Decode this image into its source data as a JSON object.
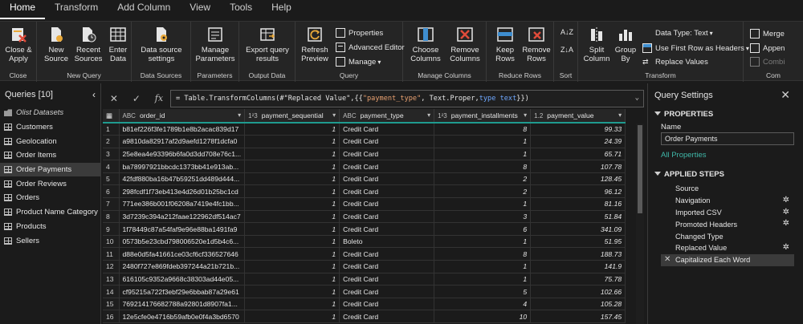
{
  "menu": {
    "tabs": [
      "Home",
      "Transform",
      "Add Column",
      "View",
      "Tools",
      "Help"
    ]
  },
  "ribbon": {
    "close_apply": "Close &\nApply",
    "new_source": "New\nSource",
    "recent_sources": "Recent\nSources",
    "enter_data": "Enter\nData",
    "data_source_settings": "Data source\nsettings",
    "manage_parameters": "Manage\nParameters",
    "export_query": "Export query\nresults",
    "refresh_preview": "Refresh\nPreview",
    "properties": "Properties",
    "advanced_editor": "Advanced Editor",
    "manage": "Manage",
    "choose_columns": "Choose\nColumns",
    "remove_columns": "Remove\nColumns",
    "keep_rows": "Keep\nRows",
    "remove_rows": "Remove\nRows",
    "split_column": "Split\nColumn",
    "group_by": "Group\nBy",
    "data_type": "Data Type: Text",
    "use_first_row": "Use First Row as Headers",
    "replace_values": "Replace Values",
    "merge": "Merge",
    "append": "Appen",
    "combine": "Combi",
    "groups": {
      "close": "Close",
      "new_query": "New Query",
      "data_sources": "Data Sources",
      "parameters": "Parameters",
      "output_data": "Output Data",
      "query": "Query",
      "manage_columns": "Manage Columns",
      "reduce_rows": "Reduce Rows",
      "sort": "Sort",
      "transform": "Transform",
      "combine": "Com"
    }
  },
  "queries": {
    "header": "Queries [10]",
    "items": [
      {
        "label": "Olist Datasets",
        "type": "folder"
      },
      {
        "label": "Customers",
        "type": "table"
      },
      {
        "label": "Geolocation",
        "type": "table"
      },
      {
        "label": "Order Items",
        "type": "table"
      },
      {
        "label": "Order Payments",
        "type": "table",
        "selected": true
      },
      {
        "label": "Order Reviews",
        "type": "table"
      },
      {
        "label": "Orders",
        "type": "table"
      },
      {
        "label": "Product Name Category",
        "type": "table"
      },
      {
        "label": "Products",
        "type": "table"
      },
      {
        "label": "Sellers",
        "type": "table"
      }
    ]
  },
  "formula": {
    "prefix": "= Table.TransformColumns(#\"Replaced Value\",{{",
    "str": "\"payment_type\"",
    "mid": ", Text.Proper, ",
    "kw": "type text",
    "suffix": "}})"
  },
  "table": {
    "columns": [
      {
        "type": "ABC",
        "name": "order_id"
      },
      {
        "type": "1²3",
        "name": "payment_sequential"
      },
      {
        "type": "ABC",
        "name": "payment_type"
      },
      {
        "type": "1²3",
        "name": "payment_installments"
      },
      {
        "type": "1.2",
        "name": "payment_value"
      }
    ],
    "rows": [
      [
        "1",
        "b81ef226f3fe1789b1e8b2acac839d17",
        "1",
        "Credit Card",
        "8",
        "99.33"
      ],
      [
        "2",
        "a9810da82917af2d9aefd1278f1dcfa0",
        "1",
        "Credit Card",
        "1",
        "24.39"
      ],
      [
        "3",
        "25e8ea4e93396b6fa0d3dd708e76c1...",
        "1",
        "Credit Card",
        "1",
        "65.71"
      ],
      [
        "4",
        "ba78997921bbcdc1373bb41e913ab...",
        "1",
        "Credit Card",
        "8",
        "107.78"
      ],
      [
        "5",
        "42fdf880ba16b47b59251dd489d444...",
        "1",
        "Credit Card",
        "2",
        "128.45"
      ],
      [
        "6",
        "298fcdf1f73eb413e4d26d01b25bc1cd",
        "1",
        "Credit Card",
        "2",
        "96.12"
      ],
      [
        "7",
        "771ee386b001f06208a7419e4fc1bb...",
        "1",
        "Credit Card",
        "1",
        "81.16"
      ],
      [
        "8",
        "3d7239c394a212faae122962df514ac7",
        "1",
        "Credit Card",
        "3",
        "51.84"
      ],
      [
        "9",
        "1f78449c87a54faf9e96e88ba1491fa9",
        "1",
        "Credit Card",
        "6",
        "341.09"
      ],
      [
        "10",
        "0573b5e23cbd798006520e1d5b4c6...",
        "1",
        "Boleto",
        "1",
        "51.95"
      ],
      [
        "11",
        "d88e0d5fa41661ce03cf6cf336527646",
        "1",
        "Credit Card",
        "8",
        "188.73"
      ],
      [
        "12",
        "2480f727e869fdeb397244a21b721b...",
        "1",
        "Credit Card",
        "1",
        "141.9"
      ],
      [
        "13",
        "616105c9352a9668c38303ad44e05...",
        "1",
        "Credit Card",
        "1",
        "75.78"
      ],
      [
        "14",
        "cf95215a722f3ebf29e6bbab87a29e61",
        "1",
        "Credit Card",
        "5",
        "102.66"
      ],
      [
        "15",
        "769214176682788a92801d8907fa1...",
        "1",
        "Credit Card",
        "4",
        "105.28"
      ],
      [
        "16",
        "12e5cfe0e4716b59afb0e0f4a3bd6570",
        "1",
        "Credit Card",
        "10",
        "157.45"
      ]
    ]
  },
  "settings": {
    "title": "Query Settings",
    "properties_head": "PROPERTIES",
    "name_label": "Name",
    "name_value": "Order Payments",
    "all_properties": "All Properties",
    "steps_head": "APPLIED STEPS",
    "steps": [
      {
        "label": "Source",
        "gear": false
      },
      {
        "label": "Navigation",
        "gear": true
      },
      {
        "label": "Imported CSV",
        "gear": true
      },
      {
        "label": "Promoted Headers",
        "gear": true
      },
      {
        "label": "Changed Type",
        "gear": false
      },
      {
        "label": "Replaced Value",
        "gear": true
      },
      {
        "label": "Capitalized Each Word",
        "gear": false,
        "selected": true
      }
    ]
  },
  "colors": {
    "accent": "#1f9b8f",
    "link": "#3fb7a8",
    "bg": "#1b1b1b"
  }
}
